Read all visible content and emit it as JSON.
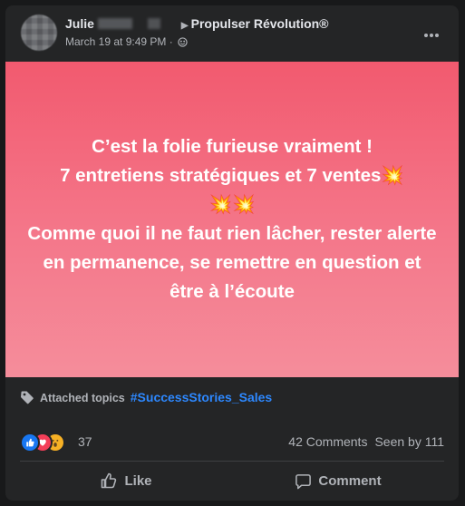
{
  "post": {
    "author_first": "Julie",
    "group_name": "Propulser Révolution®",
    "timestamp": "March 19 at 9:49 PM",
    "separator": "·",
    "body": "C’est la folie furieuse vraiment !\n7 entretiens stratégiques et 7 ventes💥\n💥💥\nComme quoi il ne faut rien lâcher, rester alerte en permanence, se remettre en question et être à l’écoute"
  },
  "topics": {
    "label": "Attached topics",
    "hashtag": "#SuccessStories_Sales"
  },
  "stats": {
    "reactions_count": "37",
    "comments": "42 Comments",
    "seen": "Seen by 111"
  },
  "actions": {
    "like": "Like",
    "comment": "Comment"
  },
  "colors": {
    "background_gradient_top": "#f25a6f",
    "background_gradient_bottom": "#f58d9b",
    "link_blue": "#2d88ff",
    "card_bg": "#242526"
  },
  "icons": [
    "more-options-icon",
    "globe-icon",
    "tag-icon",
    "like-reaction-icon",
    "love-reaction-icon",
    "wow-reaction-icon",
    "thumbs-up-icon",
    "comment-bubble-icon"
  ]
}
